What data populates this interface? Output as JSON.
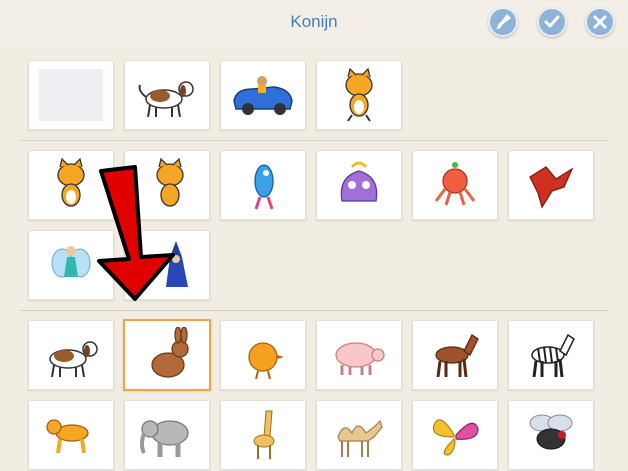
{
  "header": {
    "title": "Konijn",
    "buttons": [
      {
        "name": "paint-brush-button",
        "icon": "paint-brush-icon"
      },
      {
        "name": "confirm-button",
        "icon": "checkmark-icon"
      },
      {
        "name": "close-button",
        "icon": "close-icon"
      }
    ]
  },
  "sections": {
    "used": [
      "blank",
      "dog",
      "car",
      "cat"
    ],
    "characters": [
      "cat",
      "cat",
      "fish",
      "monster",
      "octopus",
      "dragon",
      "fairy",
      "wizard"
    ],
    "library": [
      "dog",
      "rabbit",
      "chick",
      "pig",
      "horse",
      "zebra",
      "monkey",
      "elephant",
      "giraffe",
      "camel",
      "butterfly",
      "fly"
    ]
  },
  "selected": "rabbit",
  "colors": {
    "accent": "#3e7fbe",
    "selection": "#f2a63d",
    "arrow": "#e00000"
  }
}
